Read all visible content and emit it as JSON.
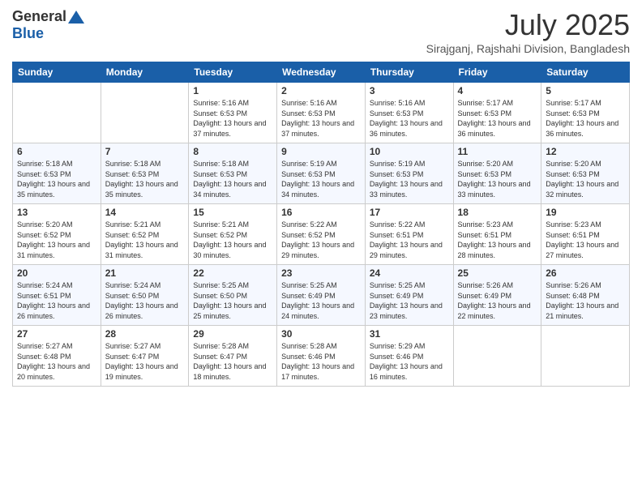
{
  "logo": {
    "general": "General",
    "blue": "Blue"
  },
  "title": {
    "month_year": "July 2025",
    "location": "Sirajganj, Rajshahi Division, Bangladesh"
  },
  "headers": [
    "Sunday",
    "Monday",
    "Tuesday",
    "Wednesday",
    "Thursday",
    "Friday",
    "Saturday"
  ],
  "weeks": [
    [
      {
        "day": "",
        "info": ""
      },
      {
        "day": "",
        "info": ""
      },
      {
        "day": "1",
        "info": "Sunrise: 5:16 AM\nSunset: 6:53 PM\nDaylight: 13 hours and 37 minutes."
      },
      {
        "day": "2",
        "info": "Sunrise: 5:16 AM\nSunset: 6:53 PM\nDaylight: 13 hours and 37 minutes."
      },
      {
        "day": "3",
        "info": "Sunrise: 5:16 AM\nSunset: 6:53 PM\nDaylight: 13 hours and 36 minutes."
      },
      {
        "day": "4",
        "info": "Sunrise: 5:17 AM\nSunset: 6:53 PM\nDaylight: 13 hours and 36 minutes."
      },
      {
        "day": "5",
        "info": "Sunrise: 5:17 AM\nSunset: 6:53 PM\nDaylight: 13 hours and 36 minutes."
      }
    ],
    [
      {
        "day": "6",
        "info": "Sunrise: 5:18 AM\nSunset: 6:53 PM\nDaylight: 13 hours and 35 minutes."
      },
      {
        "day": "7",
        "info": "Sunrise: 5:18 AM\nSunset: 6:53 PM\nDaylight: 13 hours and 35 minutes."
      },
      {
        "day": "8",
        "info": "Sunrise: 5:18 AM\nSunset: 6:53 PM\nDaylight: 13 hours and 34 minutes."
      },
      {
        "day": "9",
        "info": "Sunrise: 5:19 AM\nSunset: 6:53 PM\nDaylight: 13 hours and 34 minutes."
      },
      {
        "day": "10",
        "info": "Sunrise: 5:19 AM\nSunset: 6:53 PM\nDaylight: 13 hours and 33 minutes."
      },
      {
        "day": "11",
        "info": "Sunrise: 5:20 AM\nSunset: 6:53 PM\nDaylight: 13 hours and 33 minutes."
      },
      {
        "day": "12",
        "info": "Sunrise: 5:20 AM\nSunset: 6:53 PM\nDaylight: 13 hours and 32 minutes."
      }
    ],
    [
      {
        "day": "13",
        "info": "Sunrise: 5:20 AM\nSunset: 6:52 PM\nDaylight: 13 hours and 31 minutes."
      },
      {
        "day": "14",
        "info": "Sunrise: 5:21 AM\nSunset: 6:52 PM\nDaylight: 13 hours and 31 minutes."
      },
      {
        "day": "15",
        "info": "Sunrise: 5:21 AM\nSunset: 6:52 PM\nDaylight: 13 hours and 30 minutes."
      },
      {
        "day": "16",
        "info": "Sunrise: 5:22 AM\nSunset: 6:52 PM\nDaylight: 13 hours and 29 minutes."
      },
      {
        "day": "17",
        "info": "Sunrise: 5:22 AM\nSunset: 6:51 PM\nDaylight: 13 hours and 29 minutes."
      },
      {
        "day": "18",
        "info": "Sunrise: 5:23 AM\nSunset: 6:51 PM\nDaylight: 13 hours and 28 minutes."
      },
      {
        "day": "19",
        "info": "Sunrise: 5:23 AM\nSunset: 6:51 PM\nDaylight: 13 hours and 27 minutes."
      }
    ],
    [
      {
        "day": "20",
        "info": "Sunrise: 5:24 AM\nSunset: 6:51 PM\nDaylight: 13 hours and 26 minutes."
      },
      {
        "day": "21",
        "info": "Sunrise: 5:24 AM\nSunset: 6:50 PM\nDaylight: 13 hours and 26 minutes."
      },
      {
        "day": "22",
        "info": "Sunrise: 5:25 AM\nSunset: 6:50 PM\nDaylight: 13 hours and 25 minutes."
      },
      {
        "day": "23",
        "info": "Sunrise: 5:25 AM\nSunset: 6:49 PM\nDaylight: 13 hours and 24 minutes."
      },
      {
        "day": "24",
        "info": "Sunrise: 5:25 AM\nSunset: 6:49 PM\nDaylight: 13 hours and 23 minutes."
      },
      {
        "day": "25",
        "info": "Sunrise: 5:26 AM\nSunset: 6:49 PM\nDaylight: 13 hours and 22 minutes."
      },
      {
        "day": "26",
        "info": "Sunrise: 5:26 AM\nSunset: 6:48 PM\nDaylight: 13 hours and 21 minutes."
      }
    ],
    [
      {
        "day": "27",
        "info": "Sunrise: 5:27 AM\nSunset: 6:48 PM\nDaylight: 13 hours and 20 minutes."
      },
      {
        "day": "28",
        "info": "Sunrise: 5:27 AM\nSunset: 6:47 PM\nDaylight: 13 hours and 19 minutes."
      },
      {
        "day": "29",
        "info": "Sunrise: 5:28 AM\nSunset: 6:47 PM\nDaylight: 13 hours and 18 minutes."
      },
      {
        "day": "30",
        "info": "Sunrise: 5:28 AM\nSunset: 6:46 PM\nDaylight: 13 hours and 17 minutes."
      },
      {
        "day": "31",
        "info": "Sunrise: 5:29 AM\nSunset: 6:46 PM\nDaylight: 13 hours and 16 minutes."
      },
      {
        "day": "",
        "info": ""
      },
      {
        "day": "",
        "info": ""
      }
    ]
  ]
}
